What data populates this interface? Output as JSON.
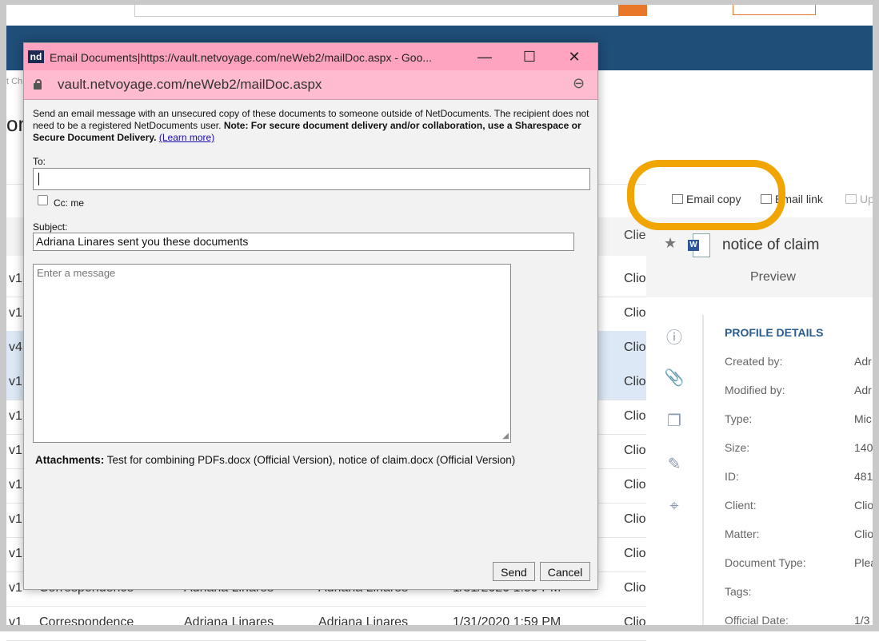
{
  "popup": {
    "window_title": "Email Documents|https://vault.netvoyage.com/neWeb2/mailDoc.aspx - Goo...",
    "logo_text": "nd",
    "url": "vault.netvoyage.com/neWeb2/mailDoc.aspx",
    "intro_text": "Send an email message with an unsecured copy of these documents to someone outside of NetDocuments. The recipient does not need to be a registered NetDocuments user. ",
    "intro_note": "Note: For secure document delivery and/or collaboration, use a Sharespace or Secure Document Delivery.",
    "learn_more": "(Learn more)",
    "to_label": "To:",
    "to_value": "",
    "cc_label": "Cc: me",
    "cc_checked": false,
    "subject_label": "Subject:",
    "subject_value": "Adriana Linares sent you these documents",
    "message_placeholder": "Enter a message",
    "attachments_label": "Attachments:",
    "attachments_value": " Test for combining PDFs.docx (Official Version), notice of claim.docx (Official Version)",
    "send_label": "Send",
    "cancel_label": "Cancel",
    "minimize": "—",
    "maximize": "☐",
    "close": "✕"
  },
  "background": {
    "crumb": "t Ch",
    "title_fragment": "on",
    "client_header": "Clie",
    "rows": [
      {
        "version": "v1",
        "client": "Clio"
      },
      {
        "version": "v1",
        "client": "Clio"
      },
      {
        "version": "v4",
        "client": "Clio"
      },
      {
        "version": "v1",
        "client": "Clio"
      },
      {
        "version": "v1",
        "client": "Clio"
      },
      {
        "version": "v1",
        "client": "Clio"
      },
      {
        "version": "v1",
        "client": "Clio"
      },
      {
        "version": "v1",
        "client": "Clio"
      },
      {
        "version": "v1",
        "client": "Clio"
      },
      {
        "version": "v1",
        "type": "Correspondence",
        "created": "Adriana Linares",
        "modified": "Adriana Linares",
        "date": "1/31/2020 1:59 PM",
        "client": "Clio"
      },
      {
        "version": "v1",
        "type": "Correspondence",
        "created": "Adriana Linares",
        "modified": "Adriana Linares",
        "date": "1/31/2020 1:59 PM",
        "client": "Clio"
      }
    ]
  },
  "toolbar": {
    "email_copy": "Email copy",
    "email_link": "Email link",
    "upload": "Up"
  },
  "details": {
    "doc_name": "notice of claim",
    "preview": "Preview",
    "section_title": "PROFILE DETAILS",
    "fields": [
      {
        "label": "Created by:",
        "value": "Adr"
      },
      {
        "label": "Modified by:",
        "value": "Adr"
      },
      {
        "label": "Type:",
        "value": "Mic"
      },
      {
        "label": "Size:",
        "value": "140"
      },
      {
        "label": "ID:",
        "value": "481"
      },
      {
        "label": "Client:",
        "value": "Clio"
      },
      {
        "label": "Matter:",
        "value": "Clio"
      },
      {
        "label": "Document Type:",
        "value": "Plea"
      },
      {
        "label": "Tags:",
        "value": ""
      },
      {
        "label": "Official Date:",
        "value": "1/3"
      }
    ]
  }
}
